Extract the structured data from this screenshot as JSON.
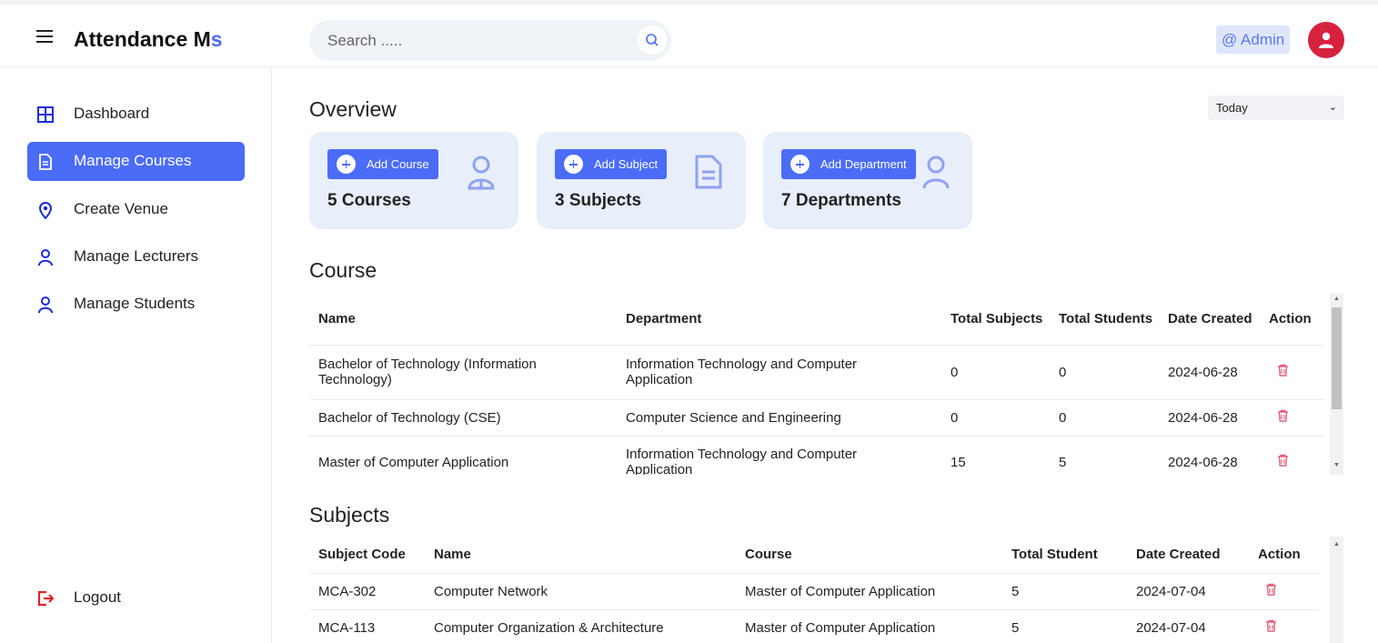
{
  "header": {
    "brand_main": "Attendance M",
    "brand_accent": "s",
    "search_placeholder": "Search .....",
    "admin_label": "@ Admin"
  },
  "sidebar": {
    "items": [
      {
        "label": "Dashboard",
        "icon": "grid-icon"
      },
      {
        "label": "Manage Courses",
        "icon": "document-icon",
        "active": true
      },
      {
        "label": "Create Venue",
        "icon": "location-pin-icon"
      },
      {
        "label": "Manage Lecturers",
        "icon": "user-icon"
      },
      {
        "label": "Manage Students",
        "icon": "user-icon"
      }
    ],
    "logout_label": "Logout"
  },
  "overview": {
    "title": "Overview",
    "period_select": "Today",
    "cards": [
      {
        "button": "Add Course",
        "count": "5 Courses",
        "icon": "person-icon"
      },
      {
        "button": "Add Subject",
        "count": "3 Subjects",
        "icon": "document-icon"
      },
      {
        "button": "Add Department",
        "count": "7 Departments",
        "icon": "person-icon"
      }
    ]
  },
  "course": {
    "title": "Course",
    "headers": [
      "Name",
      "Department",
      "Total Subjects",
      "Total Students",
      "Date Created",
      "Action"
    ],
    "rows": [
      [
        "Bachelor of Technology (Information Technology)",
        "Information Technology and Computer Application",
        "0",
        "0",
        "2024-06-28"
      ],
      [
        "Bachelor of Technology (CSE)",
        "Computer Science and Engineering",
        "0",
        "0",
        "2024-06-28"
      ],
      [
        "Master of Computer Application",
        "Information Technology and Computer Application",
        "15",
        "5",
        "2024-06-28"
      ]
    ]
  },
  "subjects": {
    "title": "Subjects",
    "headers": [
      "Subject Code",
      "Name",
      "Course",
      "Total Student",
      "Date Created",
      "Action"
    ],
    "rows": [
      [
        "MCA-302",
        "Computer Network",
        "Master of Computer Application",
        "5",
        "2024-07-04"
      ],
      [
        "MCA-113",
        "Computer Organization & Architecture",
        "Master of Computer Application",
        "5",
        "2024-07-04"
      ]
    ]
  },
  "colors": {
    "accent": "#4a6cf7",
    "danger": "#d6223f",
    "card_bg": "#e9eefb",
    "trash": "#e0607a"
  }
}
